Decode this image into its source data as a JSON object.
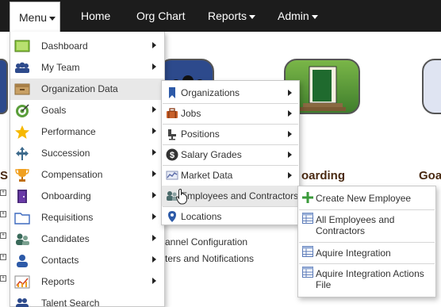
{
  "navbar": {
    "menu": "Menu",
    "home": "Home",
    "org_chart": "Org Chart",
    "reports": "Reports",
    "admin": "Admin"
  },
  "background": {
    "heading_left": "S",
    "heading_onboarding": "oarding",
    "heading_goals": "Goa",
    "link1": "annel Configuration",
    "link2": "ters and Notifications"
  },
  "main_menu": [
    {
      "label": "Dashboard",
      "icon": "dashboard-icon"
    },
    {
      "label": "My Team",
      "icon": "team-icon"
    },
    {
      "label": "Organization Data",
      "icon": "folder-box-icon"
    },
    {
      "label": "Goals",
      "icon": "target-icon"
    },
    {
      "label": "Performance",
      "icon": "star-icon"
    },
    {
      "label": "Succession",
      "icon": "arrows-icon"
    },
    {
      "label": "Compensation",
      "icon": "trophy-icon"
    },
    {
      "label": "Onboarding",
      "icon": "door-icon"
    },
    {
      "label": "Requisitions",
      "icon": "folder-icon"
    },
    {
      "label": "Candidates",
      "icon": "people-icon"
    },
    {
      "label": "Contacts",
      "icon": "person-icon"
    },
    {
      "label": "Reports",
      "icon": "report-chart-icon"
    },
    {
      "label": "Talent Search",
      "icon": "search-people-icon"
    }
  ],
  "org_submenu": [
    {
      "label": "Organizations",
      "icon": "bookmark-icon"
    },
    {
      "label": "Jobs",
      "icon": "briefcase-icon"
    },
    {
      "label": "Positions",
      "icon": "chair-icon"
    },
    {
      "label": "Salary Grades",
      "icon": "dollar-icon"
    },
    {
      "label": "Market Data",
      "icon": "chart-icon"
    },
    {
      "label": "Employees and Contractors",
      "icon": "employees-icon"
    },
    {
      "label": "Locations",
      "icon": "map-pin-icon"
    }
  ],
  "employees_submenu": [
    {
      "label": "Create New Employee",
      "icon": "plus-icon"
    },
    {
      "label": "All Employees and Contractors",
      "icon": "grid-icon"
    },
    {
      "label": "Aquire Integration",
      "icon": "grid-icon"
    },
    {
      "label": "Aquire Integration Actions File",
      "icon": "grid-icon"
    }
  ],
  "colors": {
    "navbar": "#1c1c1c",
    "hover": "#e8e8e8",
    "plus": "#3a9a3a"
  }
}
